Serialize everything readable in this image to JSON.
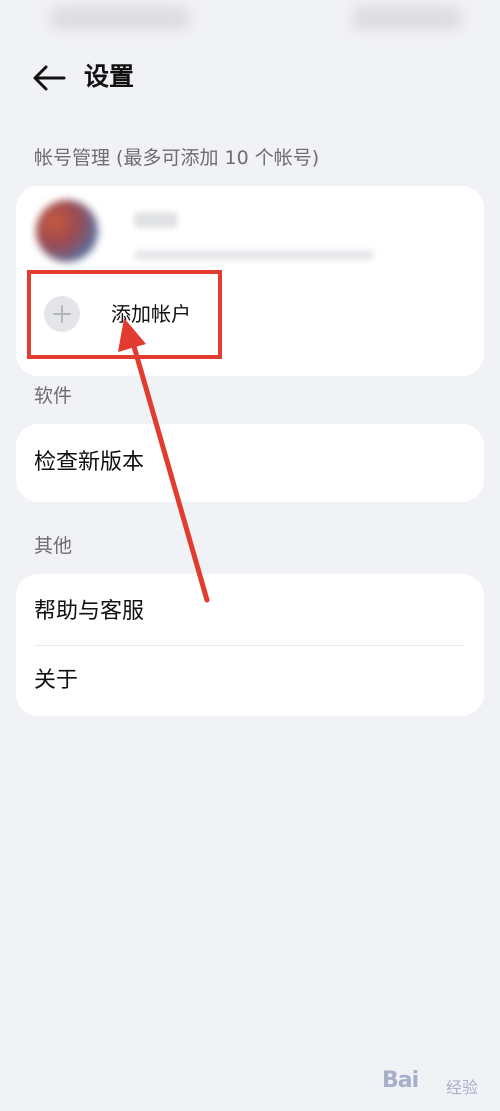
{
  "header": {
    "title": "设置",
    "back_icon": "arrow-left-icon"
  },
  "account_section": {
    "label": "帐号管理 (最多可添加 10 个帐号)",
    "add_account_label": "添加帐户",
    "add_icon": "plus-icon"
  },
  "software_section": {
    "label": "软件",
    "items": [
      {
        "label": "检查新版本"
      }
    ]
  },
  "others_section": {
    "label": "其他",
    "items": [
      {
        "label": "帮助与客服"
      },
      {
        "label": "关于"
      }
    ]
  },
  "annotation": {
    "color": "#e23b30"
  },
  "watermark": {
    "text": "Bai",
    "suffix": "经验"
  },
  "colors": {
    "background": "#f1f2f5",
    "card": "#ffffff",
    "section_label": "#6d6d72"
  }
}
